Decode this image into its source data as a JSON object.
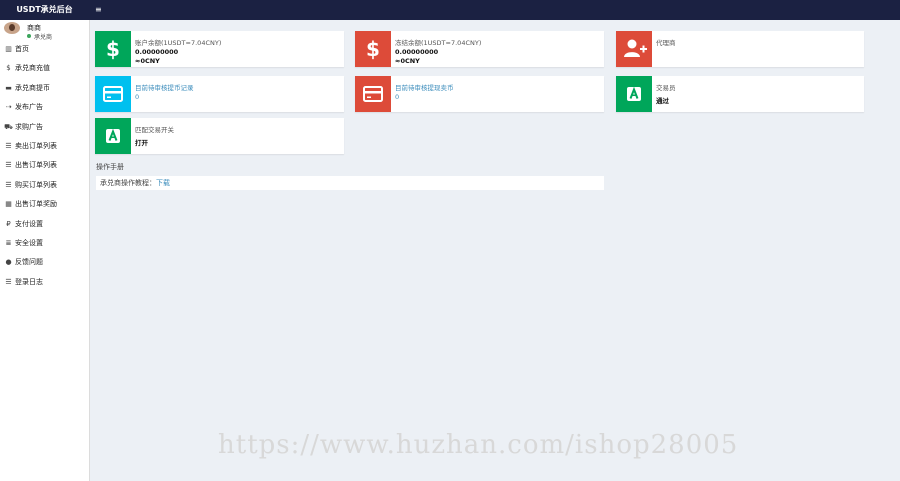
{
  "app": {
    "title": "USDT承兑后台"
  },
  "user": {
    "name": "商商",
    "status": "承兑商"
  },
  "sidebar": {
    "items": [
      {
        "icon": "bar-chart-icon",
        "glyph": "📊",
        "label": "首页"
      },
      {
        "icon": "dollar-icon",
        "glyph": "$",
        "label": "承兑商充值"
      },
      {
        "icon": "card-icon",
        "glyph": "▬",
        "label": "承兑商提币"
      },
      {
        "icon": "send-icon",
        "glyph": "⇢",
        "label": "发布广告"
      },
      {
        "icon": "cart-icon",
        "glyph": "🛒",
        "label": "求购广告"
      },
      {
        "icon": "list-icon",
        "glyph": "☰",
        "label": "卖出订单列表"
      },
      {
        "icon": "list-icon",
        "glyph": "☰",
        "label": "出售订单列表"
      },
      {
        "icon": "list-icon",
        "glyph": "☰",
        "label": "购买订单列表"
      },
      {
        "icon": "grid-icon",
        "glyph": "▦",
        "label": "出售订单奖励"
      },
      {
        "icon": "pay-icon",
        "glyph": "₽",
        "label": "支付设置"
      },
      {
        "icon": "settings-icon",
        "glyph": "≣",
        "label": "安全设置"
      },
      {
        "icon": "comment-icon",
        "glyph": "💬",
        "label": "反馈问题"
      },
      {
        "icon": "list-icon",
        "glyph": "☰",
        "label": "登录日志"
      }
    ]
  },
  "cards": [
    {
      "icon": "dollar-icon",
      "color": "#00a65a",
      "title": "账户余额(1USDT=7.04CNY)",
      "line1": "0.00000000",
      "line2": "≈0CNY"
    },
    {
      "icon": "dollar-icon",
      "color": "#dd4b39",
      "title": "冻结余额(1USDT=7.04CNY)",
      "line1": "0.00000000",
      "line2": "≈0CNY"
    },
    {
      "icon": "user-add-icon",
      "color": "#dd4b39",
      "title": "代理商",
      "line1": "",
      "line2": ""
    },
    {
      "icon": "credit-card-icon",
      "color": "#00c0ef",
      "title": "目前待审核提币记录",
      "line1": "0",
      "line2": ""
    },
    {
      "icon": "credit-card-icon",
      "color": "#dd4b39",
      "title": "目前待审核提现卖币",
      "line1": "0",
      "line2": ""
    },
    {
      "icon": "a-badge-icon",
      "color": "#00a65a",
      "title": "交易员",
      "line1": "通过",
      "line2": ""
    },
    {
      "icon": "a-badge-icon",
      "color": "#00a65a",
      "title": "匹配交易开关",
      "line1": "打开",
      "line2": ""
    }
  ],
  "manual": {
    "title": "操作手册",
    "label": "承兑商操作教程：",
    "link": "下载"
  },
  "watermark": "https://www.huzhan.com/ishop28005"
}
